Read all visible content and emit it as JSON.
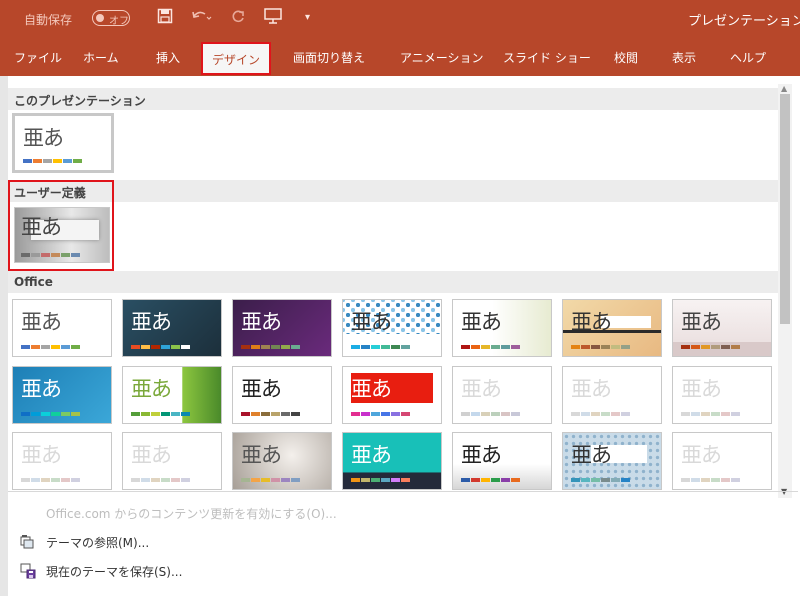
{
  "titlebar": {
    "autosave_label": "自動保存",
    "autosave_state": "オフ",
    "app_title": "プレゼンテーション"
  },
  "ribbon": {
    "tabs": [
      "ファイル",
      "ホーム",
      "挿入",
      "デザイン",
      "画面切り替え",
      "アニメーション",
      "スライド ショー",
      "校閲",
      "表示",
      "ヘルプ"
    ],
    "active_tab": "デザイン"
  },
  "gallery": {
    "sections": {
      "this_presentation": "このプレゼンテーション",
      "custom": "ユーザー定義",
      "office": "Office"
    },
    "thumbnail_text": "亜あ"
  },
  "menu": {
    "update_from_office": "Office.com からのコンテンツ更新を有効にする(O)...",
    "browse_themes": "テーマの参照(M)...",
    "save_current_theme": "現在のテーマを保存(S)..."
  },
  "colors": {
    "accent": "#b7472a",
    "highlight": "#e0141b"
  }
}
